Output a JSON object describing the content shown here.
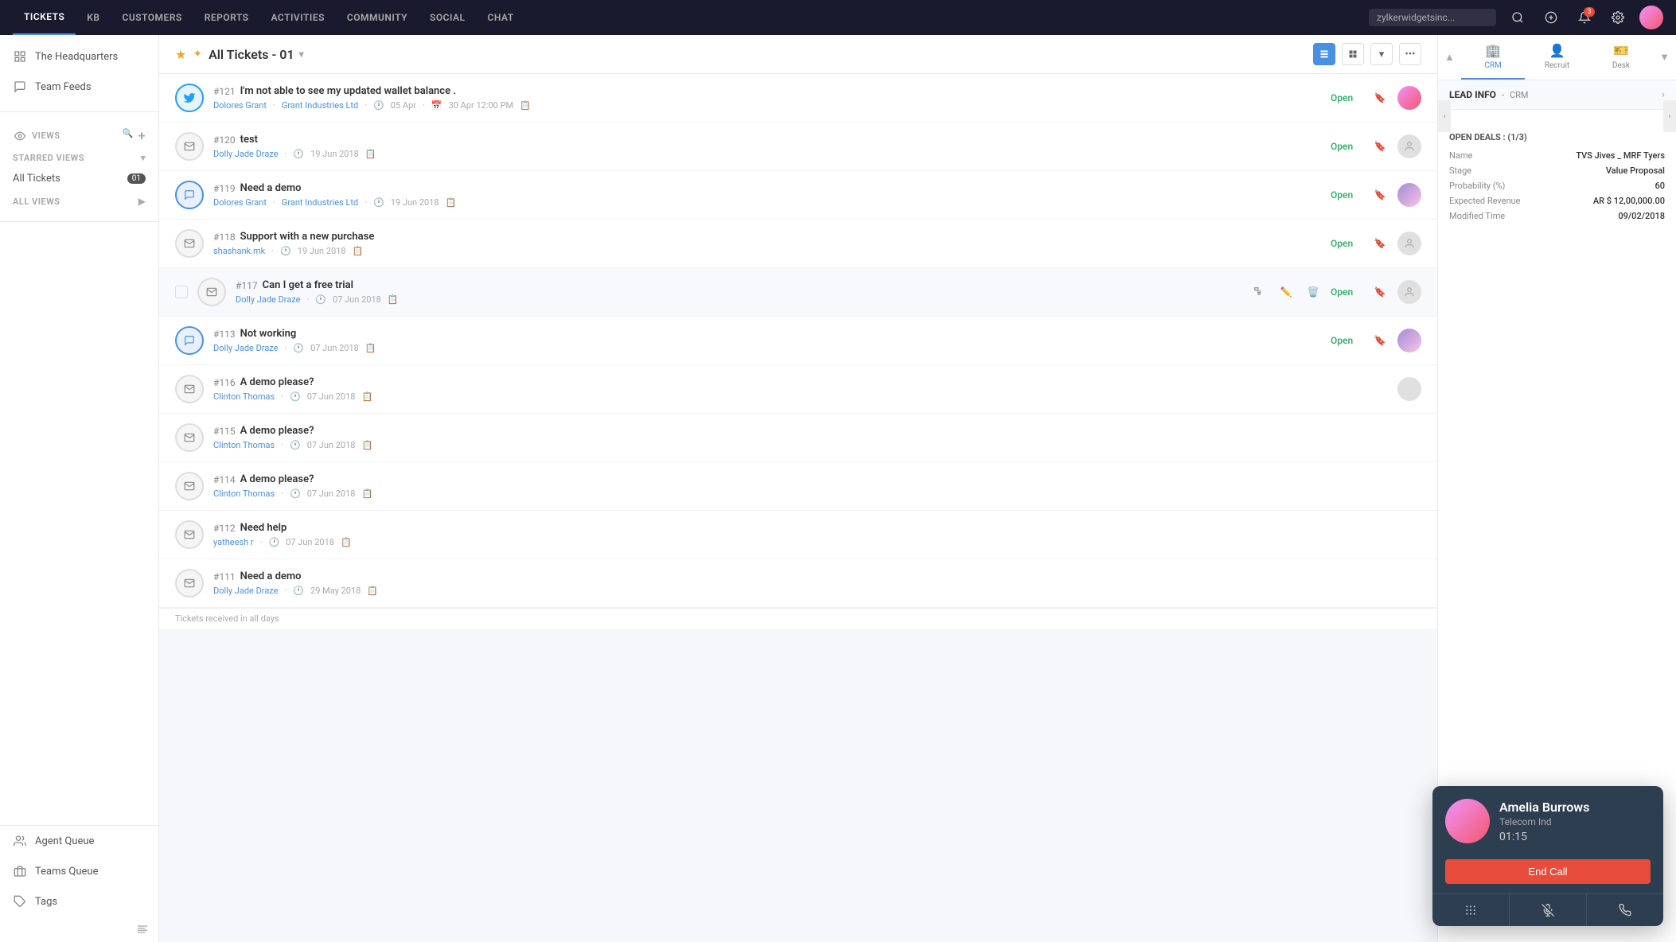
{
  "nav": {
    "items": [
      {
        "label": "TICKETS",
        "active": true
      },
      {
        "label": "KB",
        "active": false
      },
      {
        "label": "CUSTOMERS",
        "active": false
      },
      {
        "label": "REPORTS",
        "active": false
      },
      {
        "label": "ACTIVITIES",
        "active": false
      },
      {
        "label": "COMMUNITY",
        "active": false
      },
      {
        "label": "SOCIAL",
        "active": false
      },
      {
        "label": "CHAT",
        "active": false
      }
    ],
    "search_placeholder": "zylkerwidgetsinc...",
    "notification_count": "3"
  },
  "sidebar": {
    "headquarters_label": "The Headquarters",
    "teamfeeds_label": "Team Feeds",
    "views_label": "Views",
    "starred_views_label": "STARRED VIEWS",
    "all_views_label": "ALL VIEWS",
    "all_tickets_label": "All Tickets",
    "all_tickets_count": "01",
    "agent_queue_label": "Agent Queue",
    "teams_queue_label": "Teams Queue",
    "tags_label": "Tags"
  },
  "toolbar": {
    "title": "All Tickets - 01",
    "dropdown_icon": "▾"
  },
  "tickets": [
    {
      "id": "#121",
      "title": "I'm not able to see my updated wallet balance .",
      "assignee": "Dolores Grant",
      "company": "Grant Industries Ltd",
      "date1": "05 Apr",
      "date2": "30 Apr 12:00 PM",
      "status": "Open",
      "channel": "twitter",
      "has_avatar": true
    },
    {
      "id": "#120",
      "title": "test",
      "assignee": "Dolly Jade Draze",
      "company": "",
      "date1": "19 Jun 2018",
      "date2": "",
      "status": "Open",
      "channel": "email",
      "has_avatar": false
    },
    {
      "id": "#119",
      "title": "Need a demo",
      "assignee": "Dolores Grant",
      "company": "Grant Industries Ltd",
      "date1": "19 Jun 2018",
      "date2": "",
      "status": "Open",
      "channel": "chat",
      "has_avatar": true
    },
    {
      "id": "#118",
      "title": "Support with a new purchase",
      "assignee": "shashank.mk",
      "company": "",
      "date1": "19 Jun 2018",
      "date2": "",
      "status": "Open",
      "channel": "email",
      "has_avatar": false
    },
    {
      "id": "#117",
      "title": "Can I get a free trial",
      "assignee": "Dolly Jade Draze",
      "company": "",
      "date1": "07 Jun 2018",
      "date2": "",
      "status": "Open",
      "channel": "email",
      "has_avatar": false,
      "show_hover": true
    },
    {
      "id": "#113",
      "title": "Not working",
      "assignee": "Dolly Jade Draze",
      "company": "",
      "date1": "07 Jun 2018",
      "date2": "",
      "status": "Open",
      "channel": "chat",
      "has_avatar": true
    },
    {
      "id": "#116",
      "title": "A demo please?",
      "assignee": "Clinton Thomas",
      "company": "",
      "date1": "07 Jun 2018",
      "date2": "",
      "status": "",
      "channel": "email",
      "has_avatar": false
    },
    {
      "id": "#115",
      "title": "A demo please?",
      "assignee": "Clinton Thomas",
      "company": "",
      "date1": "07 Jun 2018",
      "date2": "",
      "status": "",
      "channel": "email",
      "has_avatar": false
    },
    {
      "id": "#114",
      "title": "A demo please?",
      "assignee": "Clinton Thomas",
      "company": "",
      "date1": "07 Jun 2018",
      "date2": "",
      "status": "",
      "channel": "email",
      "has_avatar": false
    },
    {
      "id": "#112",
      "title": "Need help",
      "assignee": "yatheesh r",
      "company": "",
      "date1": "07 Jun 2018",
      "date2": "",
      "status": "",
      "channel": "email",
      "has_avatar": false
    },
    {
      "id": "#111",
      "title": "Need a demo",
      "assignee": "Dolly Jade Draze",
      "company": "",
      "date1": "29 May 2018",
      "date2": "",
      "status": "",
      "channel": "email",
      "has_avatar": false
    }
  ],
  "status_bar": {
    "text": "Tickets received in all days"
  },
  "call_widget": {
    "name": "Amelia Burrows",
    "company": "Telecom Ind",
    "timer": "01:15",
    "end_call_label": "End Call"
  },
  "side_panel": {
    "lead_info_label": "LEAD INFO",
    "crm_label": "CRM",
    "open_deals_label": "OPEN DEALS : (1/3)",
    "fields": [
      {
        "label": "Name",
        "value": "TVS Jives _ MRF Tyers"
      },
      {
        "label": "Stage",
        "value": "Value Proposal"
      },
      {
        "label": "Probability (%)",
        "value": "60"
      },
      {
        "label": "Expected Revenue",
        "value": "AR $ 12,00,000.00"
      },
      {
        "label": "Modified Time",
        "value": "09/02/2018"
      }
    ],
    "tabs": [
      {
        "label": "CRM",
        "icon": "🏢"
      },
      {
        "label": "Recruit",
        "icon": "👤"
      },
      {
        "label": "Desk",
        "icon": "🎫"
      }
    ]
  }
}
